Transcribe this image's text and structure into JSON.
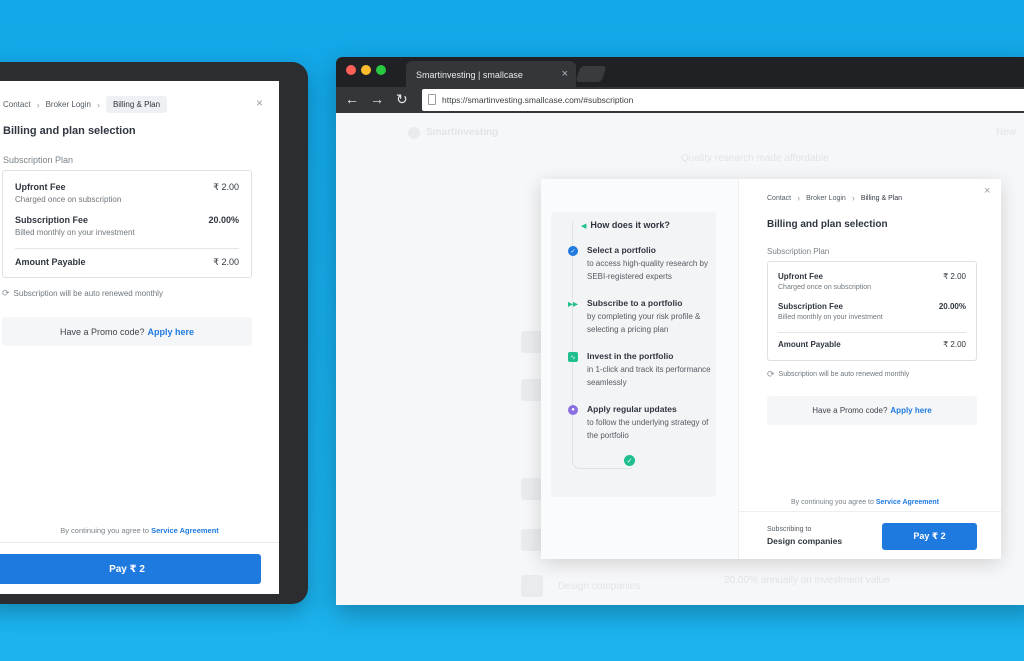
{
  "checkout": {
    "breadcrumbs": [
      "Contact",
      "Broker Login",
      "Billing & Plan"
    ],
    "close": "×",
    "title": "Billing and plan selection",
    "plan_label": "Subscription Plan",
    "upfront": {
      "name": "Upfront Fee",
      "desc": "Charged once on subscription",
      "amount": "₹ 2.00"
    },
    "subscription": {
      "name": "Subscription Fee",
      "desc": "Billed monthly on your investment",
      "amount": "20.00%"
    },
    "payable": {
      "name": "Amount Payable",
      "amount": "₹ 2.00"
    },
    "renew_note": "Subscription will be auto renewed monthly",
    "promo_text": "Have a Promo code?",
    "promo_link": "Apply here",
    "agree_text": "By continuing you agree to",
    "agree_link": "Service Agreement",
    "subscribing_label": "Subscribing to",
    "subscribing_name": "Design companies",
    "pay_label": "Pay ₹ 2"
  },
  "browser": {
    "tab_title": "Smartinvesting | smallcase",
    "url": "https://smartinvesting.smallcase.com/#subscription",
    "back_icon": "←",
    "forward_icon": "→",
    "reload_icon": "↻"
  },
  "how_it_works": {
    "title": "How does it work?",
    "steps": [
      {
        "title": "Select a portfolio",
        "desc": "to access high-quality research by SEBI-registered experts",
        "icon": "check-circle-icon",
        "color": "#1f7ae0"
      },
      {
        "title": "Subscribe to a portfolio",
        "desc": "by completing your risk profile & selecting a pricing plan",
        "icon": "fast-forward-icon",
        "color": "#1fbf8f"
      },
      {
        "title": "Invest in the portfolio",
        "desc": "in 1-click and track its performance seamlessly",
        "icon": "pulse-icon",
        "color": "#1fbf8f"
      },
      {
        "title": "Apply regular updates",
        "desc": "to follow the underlying strategy of the portfolio",
        "icon": "palette-icon",
        "color": "#8b6fe0"
      }
    ]
  },
  "background_page": {
    "brand": "Smartinvesting",
    "nav_right": "New",
    "tagline": "Quality research made affordable",
    "list_item_name": "Design companies",
    "list_item_info": "20.00% annually on investment value"
  }
}
